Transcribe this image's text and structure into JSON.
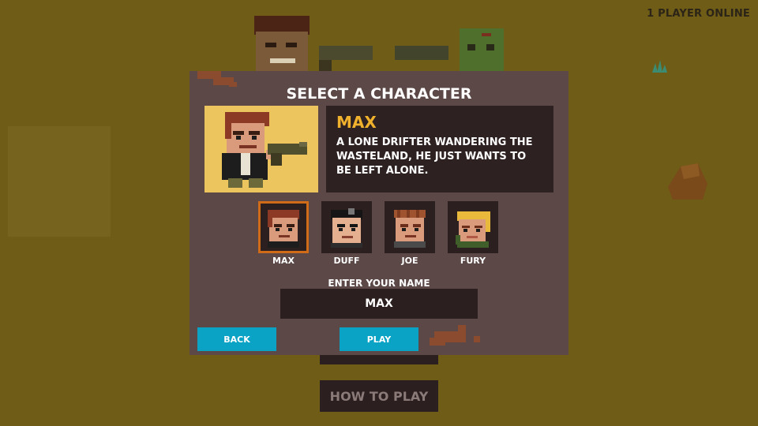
{
  "status": {
    "players_online": "1 PLAYER ONLINE"
  },
  "background_menu": {
    "how_to_play": "HOW TO PLAY"
  },
  "modal": {
    "title": "SELECT A CHARACTER",
    "selected": {
      "name": "MAX",
      "description": "A LONE DRIFTER WANDERING THE WASTELAND, HE JUST WANTS TO BE LEFT ALONE."
    },
    "characters": [
      {
        "name": "MAX",
        "selected": true,
        "hair": "#8c3a25",
        "skin": "#d99b7c"
      },
      {
        "name": "DUFF",
        "selected": false,
        "hair": "#151515",
        "skin": "#e5b08f"
      },
      {
        "name": "JOE",
        "selected": false,
        "hair": "#a0532f",
        "skin": "#d99b7c"
      },
      {
        "name": "FURY",
        "selected": false,
        "hair": "#e8b93a",
        "skin": "#d99b7c"
      }
    ],
    "name_label": "ENTER YOUR NAME",
    "name_value": "MAX",
    "back_label": "BACK",
    "play_label": "PLAY"
  },
  "colors": {
    "accent": "#d06c17",
    "button": "#0aa2c5",
    "name_highlight": "#f0b12d"
  }
}
